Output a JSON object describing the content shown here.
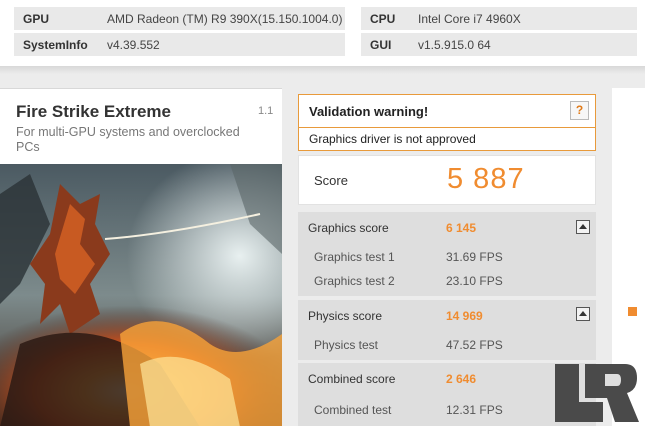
{
  "system": {
    "gpu_label": "GPU",
    "gpu_value": "AMD Radeon (TM) R9 390X(15.150.1004.0)",
    "sysinfo_label": "SystemInfo",
    "sysinfo_value": "v4.39.552",
    "cpu_label": "CPU",
    "cpu_value": "Intel Core i7 4960X",
    "gui_label": "GUI",
    "gui_value": "v1.5.915.0 64"
  },
  "benchmark": {
    "title": "Fire Strike Extreme",
    "version": "1.1",
    "description": "For multi-GPU systems and overclocked PCs"
  },
  "validation": {
    "title": "Validation warning!",
    "help": "?",
    "message": "Graphics driver is not approved"
  },
  "score": {
    "label": "Score",
    "value": "5 887"
  },
  "graphics": {
    "label": "Graphics score",
    "value": "6 145",
    "tests": [
      {
        "label": "Graphics test 1",
        "value": "31.69 FPS"
      },
      {
        "label": "Graphics test 2",
        "value": "23.10 FPS"
      }
    ]
  },
  "physics": {
    "label": "Physics score",
    "value": "14 969",
    "tests": [
      {
        "label": "Physics test",
        "value": "47.52 FPS"
      }
    ]
  },
  "combined": {
    "label": "Combined score",
    "value": "2 646",
    "tests": [
      {
        "label": "Combined test",
        "value": "12.31 FPS"
      }
    ]
  },
  "colors": {
    "accent": "#f08c30",
    "warning_border": "#e89a3b"
  },
  "icons": [
    "help-icon",
    "collapse-icon",
    "legit-reviews-logo"
  ]
}
